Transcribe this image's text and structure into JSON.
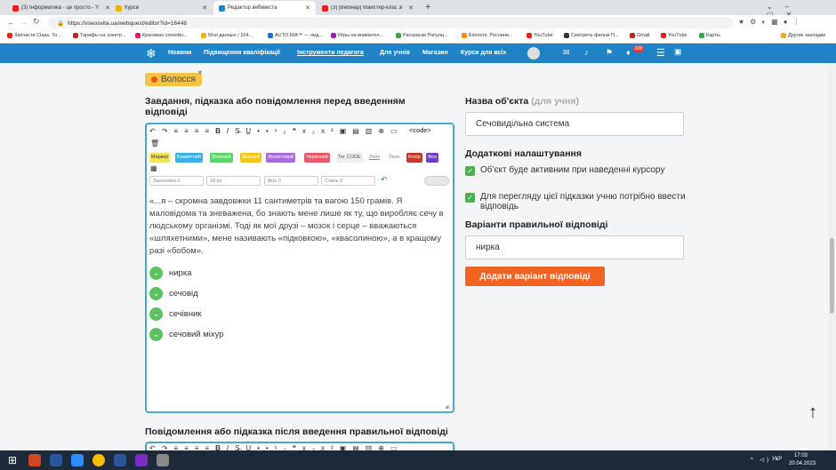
{
  "browser": {
    "tabs": [
      {
        "title": "(3) Інформатика - це просто - Y",
        "color": "#e62117"
      },
      {
        "title": "Курси",
        "color": "#f0b400"
      },
      {
        "title": "Редактор вебквеста",
        "color": "#1f83c6"
      },
      {
        "title": "(3) [Вебінар] Майстер-клас зі ст",
        "color": "#e62117"
      }
    ],
    "url": "https://vseosvita.ua/webquest/editor?id=16448",
    "bookmarks": [
      "Запчасти Claas. То...",
      "Тарифы на электр...",
      "Красивая спокойн...",
      "Мои данные / 104...",
      "AUTO.RIA™ — лид...",
      "Игры на внимател...",
      "Раскраски Рапунц...",
      "Біологія: Рослини...",
      "YouTube",
      "Смотреть фильм П...",
      "Gmail",
      "YouTube",
      "Карты",
      "Другие закладки"
    ]
  },
  "nav": {
    "items": [
      "Новини",
      "Підвищення кваліфікації",
      "Інструменти педагога",
      "Для учнів",
      "Магазин",
      "Курси для всіх"
    ],
    "badge": "628"
  },
  "tag": {
    "label": "Волосся"
  },
  "task": {
    "heading": "Завдання, підказка або повідомлення перед введенням відповіді",
    "text": "«...я – скромна завдовжки 11 сантиметрів та вагою 150 грамів. Я маловідома та зневажена, бо знають мене лише як ту, що виробляє сечу в людському організмі. Тоді як мої друзі – мозок і серце – вважаються «шляхетними», мене називають «підковкою», «квасолиною», а в кращому разі «бобом».",
    "answers": [
      "нирка",
      "сечовід",
      "сечівник",
      "сечовий міхур"
    ]
  },
  "toolbar": {
    "chips": [
      {
        "label": "Маркер",
        "color": "#f6e05e",
        "text": "#333"
      },
      {
        "label": "Блакитний",
        "color": "#3ab0e2",
        "text": "#fff"
      },
      {
        "label": "Зелений",
        "color": "#5ed36b",
        "text": "#fff"
      },
      {
        "label": "Жовтий",
        "color": "#f5c518",
        "text": "#fff"
      },
      {
        "label": "Фіолетовий",
        "color": "#a66bd8",
        "text": "#fff"
      },
      {
        "label": "Червоний",
        "color": "#e85a6a",
        "text": "#fff"
      },
      {
        "label": "Тег CODE",
        "color": "#eeeeee",
        "text": "#555"
      },
      {
        "label": "Лінія",
        "color": "#ffffff",
        "text": "#888"
      },
      {
        "label": "Лінія",
        "color": "#ffffff",
        "text": "#888"
      },
      {
        "label": "Колір",
        "color": "#c0392b",
        "text": "#fff"
      },
      {
        "label": "Фон",
        "color": "#6c3fc5",
        "text": "#fff"
      }
    ],
    "heading_placeholder": "Заголовок 0",
    "size_placeholder": "18 px",
    "bg_placeholder": "Фон 0",
    "style_placeholder": "Стиль 0",
    "code_label": "<code>"
  },
  "object": {
    "name_label": "Назва об'єкта",
    "name_hint": "(для учня)",
    "name_value": "Сечовидільна система",
    "extra_heading": "Додаткові налаштування",
    "opt1": "Об'єкт буде активним при наведенні курсору",
    "opt2": "Для перегляду цієї підказки учню потрібно ввести відповідь",
    "answers_heading": "Варіанти правильної відповіді",
    "answer_value": "нирка",
    "add_button": "Додати варіант відповіді"
  },
  "after": {
    "heading": "Повідомлення або підказка після введення правильної відповіді"
  },
  "taskbar": {
    "lang": "УКР",
    "time": "17:03",
    "date": "20.04.2023"
  }
}
